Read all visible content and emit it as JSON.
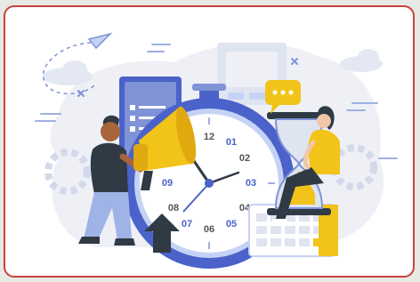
{
  "illustration": {
    "clock_numbers": {
      "n12": "12",
      "n01": "01",
      "n02": "02",
      "n03": "03",
      "n04": "04",
      "n05": "05",
      "n06": "06",
      "n07": "07",
      "n08": "08",
      "n09": "09"
    },
    "colors": {
      "border": "#c9413c",
      "blob": "#eef0f6",
      "accent_blue": "#4a62c9",
      "light_blue": "#c6d2f5",
      "yellow": "#f2c318",
      "skin": "#a8653a",
      "dark": "#2f3a45"
    }
  }
}
